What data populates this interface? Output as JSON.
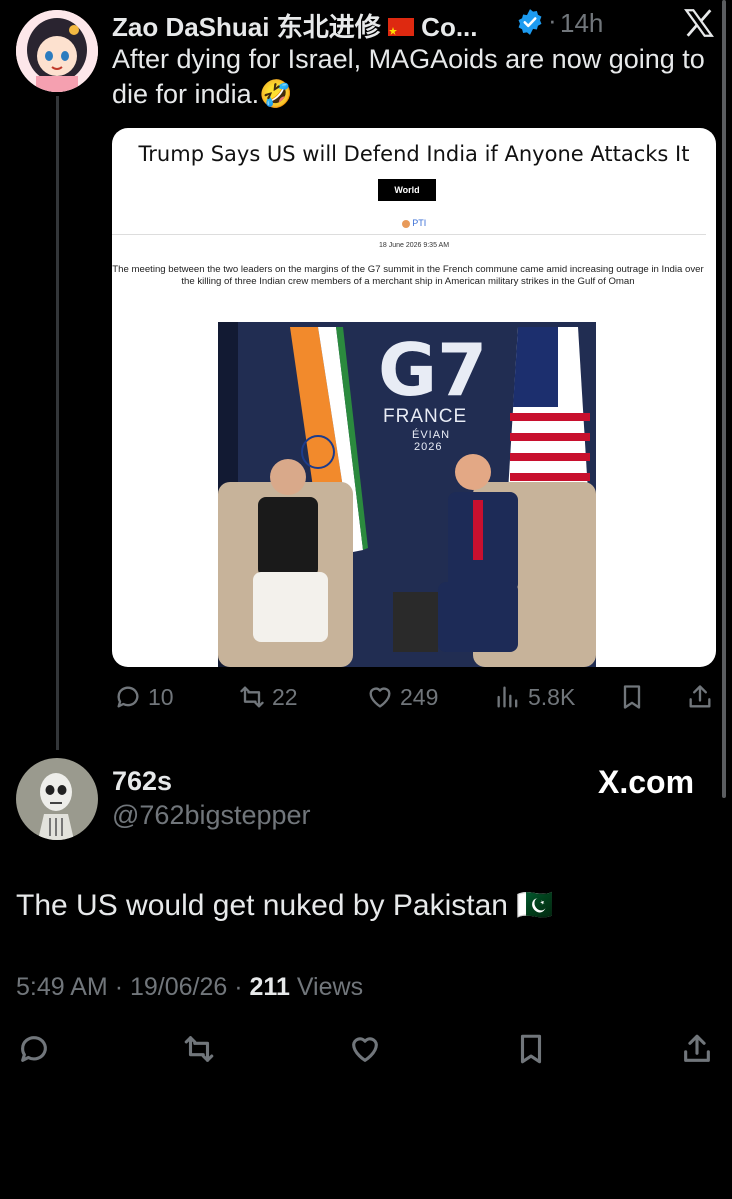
{
  "tweet": {
    "author_name": "Zao DaShuai 东北进修",
    "author_name_truncated": "Co...",
    "time_ago": "14h",
    "text": "After dying for Israel, MAGAoids are now going to die for india.🤣",
    "card": {
      "headline": "Trump Says US will Defend India if Anyone Attacks It",
      "section": "World",
      "byline": "PTI",
      "date": "18 June 2026 9:35 AM",
      "lede": "The meeting between the two leaders on the margins of the G7 summit in the French commune came amid increasing outrage in India over the killing of three Indian crew members of a merchant ship in American military strikes in the Gulf of Oman",
      "photo_banner": {
        "logo": "G7",
        "country": "FRANCE",
        "city": "ÉVIAN",
        "year": "2026"
      }
    },
    "actions": {
      "replies": "10",
      "reposts": "22",
      "likes": "249",
      "views": "5.8K"
    }
  },
  "reply": {
    "display_name": "762s",
    "handle": "@762bigstepper",
    "watermark": "X.com",
    "text": "The US would get nuked by Pakistan 🇵🇰",
    "time": "5:49 AM",
    "date": "19/06/26",
    "views_count": "211",
    "views_label": "Views"
  },
  "icons": [
    "close-x-icon",
    "verified-badge-icon",
    "reply-icon",
    "repost-icon",
    "like-icon",
    "views-icon",
    "bookmark-icon",
    "share-icon"
  ],
  "colors": {
    "background": "#000000",
    "text": "#e7e9ea",
    "muted": "#71767b",
    "verified": "#1d9bf0",
    "link": "#3b6fd6"
  }
}
